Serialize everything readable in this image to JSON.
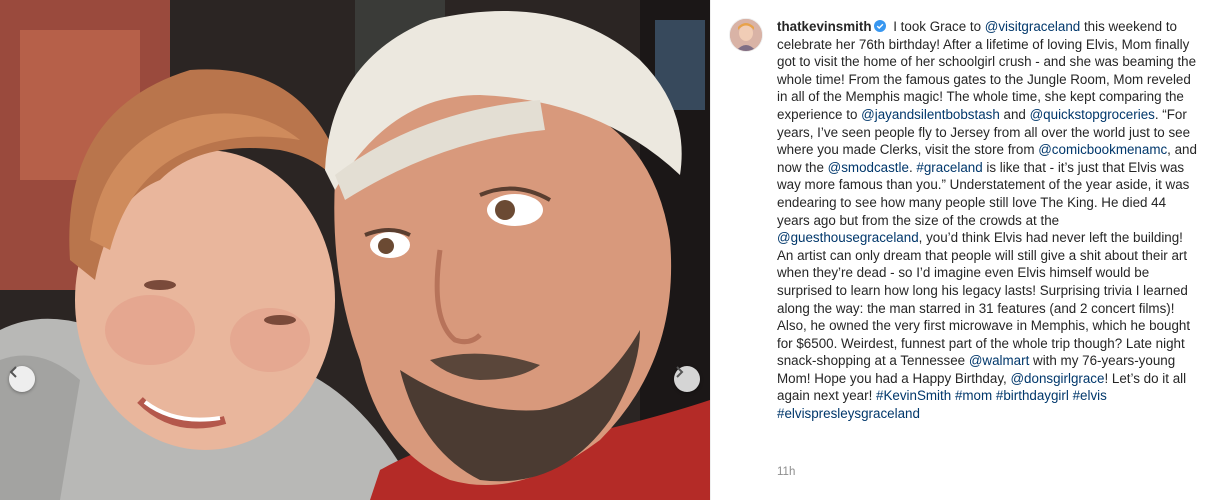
{
  "post": {
    "username": "thatkevinsmith",
    "verified_icon": "verified-badge-icon",
    "timestamp": "11h",
    "caption_segments": [
      {
        "type": "text",
        "text": " I took Grace to "
      },
      {
        "type": "mention",
        "text": "@visitgraceland"
      },
      {
        "type": "text",
        "text": " this weekend to celebrate her 76th birthday! After a lifetime of loving Elvis, Mom finally got to visit the home of her schoolgirl crush - and she was beaming the whole time! From the famous gates to the Jungle Room, Mom reveled in all of the Memphis magic! The whole time, she kept comparing the experience to "
      },
      {
        "type": "mention",
        "text": "@jayandsilentbobstash"
      },
      {
        "type": "text",
        "text": " and "
      },
      {
        "type": "mention",
        "text": "@quickstopgroceries"
      },
      {
        "type": "text",
        "text": ". “For years, I’ve seen people fly to Jersey from all over the world just to see where you made Clerks, visit the store from "
      },
      {
        "type": "mention",
        "text": "@comicbookmenamc"
      },
      {
        "type": "text",
        "text": ", and now the "
      },
      {
        "type": "mention",
        "text": "@smodcastle"
      },
      {
        "type": "text",
        "text": ". "
      },
      {
        "type": "hashtag",
        "text": "#graceland"
      },
      {
        "type": "text",
        "text": " is like that - it’s just that Elvis was way more famous than you.” Understatement of the year aside, it was endearing to see how many people still love The King. He died 44 years ago but from the size of the crowds at the "
      },
      {
        "type": "mention",
        "text": "@guesthousegraceland"
      },
      {
        "type": "text",
        "text": ", you’d think Elvis had never left the building! An artist can only dream that people will still give a shit about their art when they’re dead - so I’d imagine even Elvis himself would be surprised to learn how long his legacy lasts! Surprising trivia I learned along the way: the man starred in 31 features (and 2 concert films)! Also, he owned the very first microwave in Memphis, which he bought for $6500. Weirdest, funnest part of the whole trip though? Late night snack-shopping at a Tennessee "
      },
      {
        "type": "mention",
        "text": "@walmart"
      },
      {
        "type": "text",
        "text": " with my 76-years-young Mom! Hope you had a Happy Birthday, "
      },
      {
        "type": "mention",
        "text": "@donsgirlgrace"
      },
      {
        "type": "text",
        "text": "! Let’s do it all again next year! "
      },
      {
        "type": "hashtag",
        "text": "#KevinSmith"
      },
      {
        "type": "text",
        "text": " "
      },
      {
        "type": "hashtag",
        "text": "#mom"
      },
      {
        "type": "text",
        "text": " "
      },
      {
        "type": "hashtag",
        "text": "#birthdaygirl"
      },
      {
        "type": "text",
        "text": " "
      },
      {
        "type": "hashtag",
        "text": "#elvis"
      },
      {
        "type": "text",
        "text": " "
      },
      {
        "type": "hashtag",
        "text": "#elvispresleysgraceland"
      }
    ]
  },
  "photo": {
    "prev_icon": "chevron-left-icon",
    "next_icon": "chevron-right-icon"
  },
  "colors": {
    "link": "#00376b",
    "text": "#262626",
    "muted": "#8e8e8e",
    "verified": "#3897f0"
  }
}
